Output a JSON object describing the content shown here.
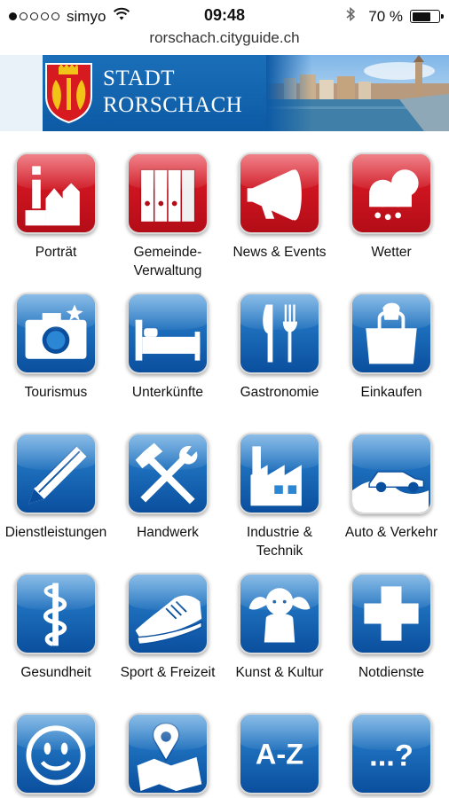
{
  "status_bar": {
    "signal_dots_filled": 1,
    "signal_dots_total": 5,
    "carrier": "simyo",
    "time": "09:48",
    "battery_text": "70 %",
    "battery_level": 0.7
  },
  "address_bar": {
    "url": "rorschach.cityguide.ch"
  },
  "header": {
    "title_line1": "STADT",
    "title_line2": "RORSCHACH"
  },
  "tiles": [
    {
      "label": "Porträt",
      "icon": "portrait-icon",
      "color": "red"
    },
    {
      "label": "Gemeinde-\nVerwaltung",
      "icon": "folders-icon",
      "color": "red"
    },
    {
      "label": "News & Events",
      "icon": "megaphone-icon",
      "color": "red"
    },
    {
      "label": "Wetter",
      "icon": "weather-cloud-icon",
      "color": "red"
    },
    {
      "label": "Tourismus",
      "icon": "camera-icon",
      "color": "blue"
    },
    {
      "label": "Unterkünfte",
      "icon": "bed-icon",
      "color": "blue"
    },
    {
      "label": "Gastronomie",
      "icon": "cutlery-icon",
      "color": "blue"
    },
    {
      "label": "Einkaufen",
      "icon": "shopping-bag-icon",
      "color": "blue"
    },
    {
      "label": "Dienstleistungen",
      "icon": "pencil-icon",
      "color": "blue"
    },
    {
      "label": "Handwerk",
      "icon": "tools-icon",
      "color": "blue"
    },
    {
      "label": "Industrie &\nTechnik",
      "icon": "factory-icon",
      "color": "blue"
    },
    {
      "label": "Auto & Verkehr",
      "icon": "car-icon",
      "color": "blue"
    },
    {
      "label": "Gesundheit",
      "icon": "caduceus-icon",
      "color": "blue"
    },
    {
      "label": "Sport & Freizeit",
      "icon": "sneaker-icon",
      "color": "blue"
    },
    {
      "label": "Kunst & Kultur",
      "icon": "cherub-icon",
      "color": "blue"
    },
    {
      "label": "Notdienste",
      "icon": "cross-icon",
      "color": "blue"
    },
    {
      "label": "",
      "icon": "smiley-icon",
      "color": "blue"
    },
    {
      "label": "",
      "icon": "map-pin-icon",
      "color": "blue"
    },
    {
      "label": "",
      "icon": "a-z-icon",
      "color": "blue",
      "icon_text": "A-Z"
    },
    {
      "label": "",
      "icon": "more-question-icon",
      "color": "blue",
      "icon_text": "...?"
    }
  ]
}
